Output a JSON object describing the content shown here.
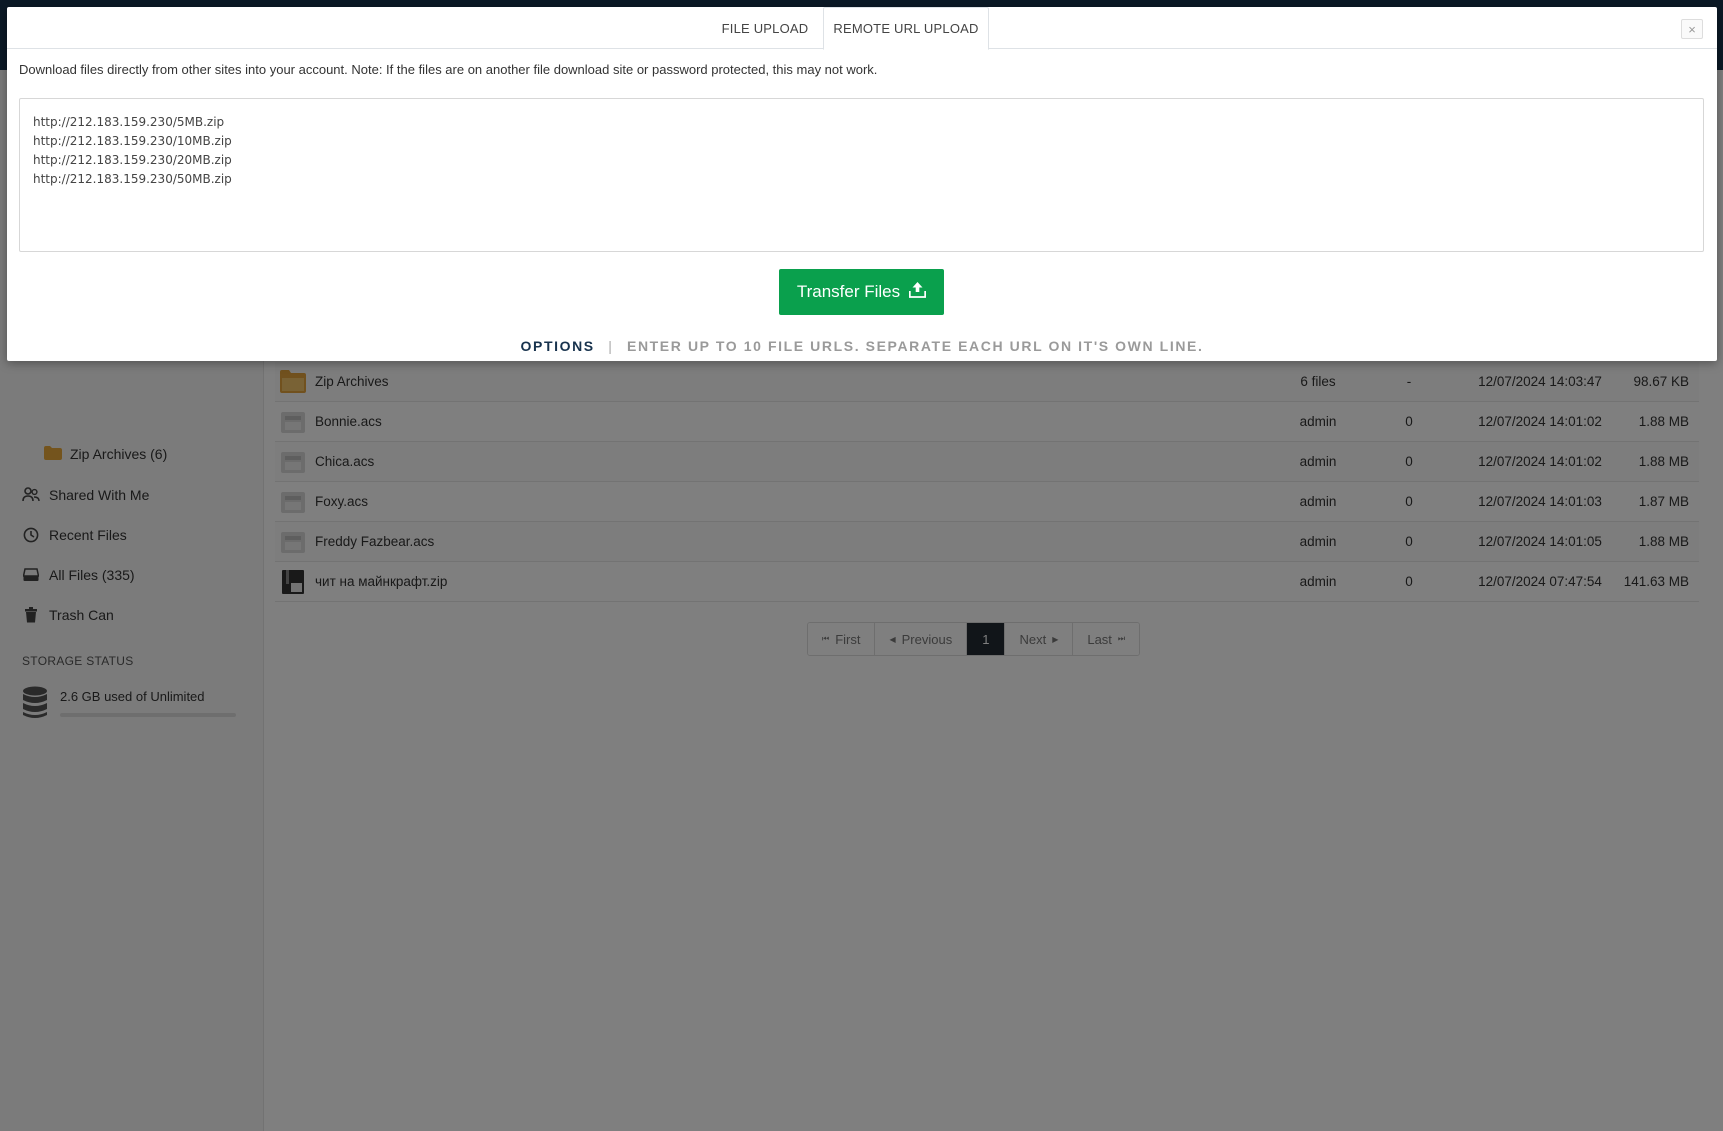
{
  "modal": {
    "tabs": [
      {
        "label": "FILE UPLOAD"
      },
      {
        "label": "REMOTE URL UPLOAD"
      }
    ],
    "close_glyph": "×",
    "note": "Download files directly from other sites into your account. Note: If the files are on another file download site or password protected, this may not work.",
    "urls_text": "http://212.183.159.230/5MB.zip\nhttp://212.183.159.230/10MB.zip\nhttp://212.183.159.230/20MB.zip\nhttp://212.183.159.230/50MB.zip",
    "transfer_label": "Transfer Files",
    "options_label": "OPTIONS",
    "options_sep": "|",
    "options_hint": "ENTER UP TO 10 FILE URLS. SEPARATE EACH URL ON IT'S OWN LINE."
  },
  "sidebar": {
    "folder": {
      "label": "Zip Archives (6)"
    },
    "items": [
      {
        "label": "Shared With Me",
        "icon": "users-icon"
      },
      {
        "label": "Recent Files",
        "icon": "clock-icon"
      },
      {
        "label": "All Files (335)",
        "icon": "drive-icon"
      },
      {
        "label": "Trash Can",
        "icon": "trash-icon"
      }
    ],
    "storage_title": "STORAGE STATUS",
    "storage_text": "2.6 GB used of Unlimited",
    "storage_used_fraction": 0.0
  },
  "files": [
    {
      "name": "Zip Archives",
      "owner": "6 files",
      "shares": "-",
      "date": "12/07/2024 14:03:47",
      "size": "98.67 KB",
      "icon": "folder-icon"
    },
    {
      "name": "Bonnie.acs",
      "owner": "admin",
      "shares": "0",
      "date": "12/07/2024 14:01:02",
      "size": "1.88 MB",
      "icon": "file-icon"
    },
    {
      "name": "Chica.acs",
      "owner": "admin",
      "shares": "0",
      "date": "12/07/2024 14:01:02",
      "size": "1.88 MB",
      "icon": "file-icon"
    },
    {
      "name": "Foxy.acs",
      "owner": "admin",
      "shares": "0",
      "date": "12/07/2024 14:01:03",
      "size": "1.87 MB",
      "icon": "file-icon"
    },
    {
      "name": "Freddy Fazbear.acs",
      "owner": "admin",
      "shares": "0",
      "date": "12/07/2024 14:01:05",
      "size": "1.88 MB",
      "icon": "file-icon"
    },
    {
      "name": "чит на майнкрафт.zip",
      "owner": "admin",
      "shares": "0",
      "date": "12/07/2024 07:47:54",
      "size": "141.63 MB",
      "icon": "zip-file-icon"
    }
  ],
  "pagination": {
    "first": "First",
    "previous": "Previous",
    "current": "1",
    "next": "Next",
    "last": "Last"
  },
  "colors": {
    "accent_green": "#0aa04d",
    "topbar": "#17324d",
    "active_page": "#232b33"
  }
}
